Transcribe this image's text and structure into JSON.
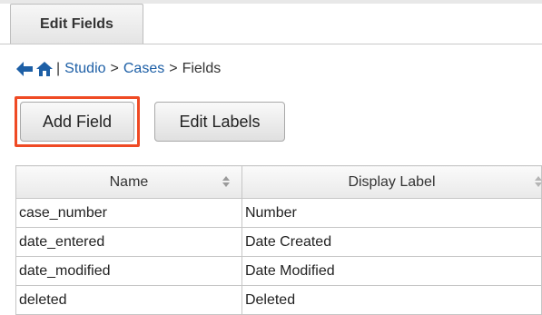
{
  "tab": {
    "label": "Edit Fields"
  },
  "breadcrumb": {
    "separator": ">",
    "items": [
      "Studio",
      "Cases",
      "Fields"
    ],
    "icons": [
      "back-arrow-icon",
      "home-icon"
    ]
  },
  "toolbar": {
    "add_field_label": "Add Field",
    "edit_labels_label": "Edit Labels",
    "highlight_color": "#ef4a24"
  },
  "table": {
    "columns": [
      "Name",
      "Display Label"
    ],
    "rows": [
      [
        "case_number",
        "Number"
      ],
      [
        "date_entered",
        "Date Created"
      ],
      [
        "date_modified",
        "Date Modified"
      ],
      [
        "deleted",
        "Deleted"
      ]
    ]
  }
}
